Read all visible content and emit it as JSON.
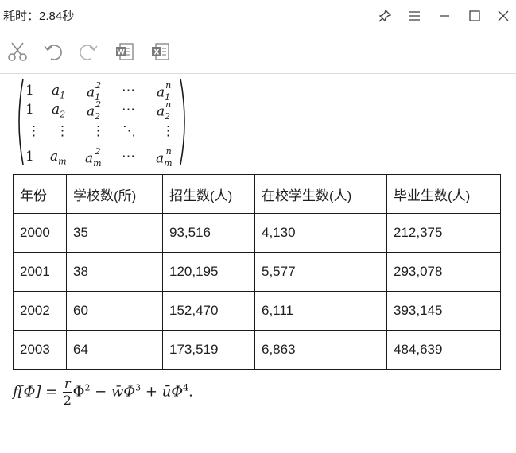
{
  "window": {
    "title": "耗时：2.84秒"
  },
  "toolbar": {
    "cut_icon": "scissors-icon",
    "undo_icon": "undo-icon",
    "redo_icon": "redo-icon",
    "word_icon": "word-export-icon",
    "excel_icon": "excel-export-icon"
  },
  "matrix": {
    "rows": [
      [
        "1",
        "a",
        "1",
        "a",
        "1",
        "2",
        "⋯",
        "a",
        "1",
        "n"
      ],
      [
        "1",
        "a",
        "2",
        "a",
        "2",
        "2",
        "⋯",
        "a",
        "2",
        "n"
      ],
      [
        "⋮",
        "⋮",
        "",
        "⋮",
        "",
        "",
        "⋱",
        "⋮",
        "",
        ""
      ],
      [
        "1",
        "a",
        "m",
        "a",
        "m",
        "2",
        "⋯",
        "a",
        "m",
        "n"
      ]
    ]
  },
  "table": {
    "headers": [
      "年份",
      "学校数(所)",
      "招生数(人)",
      "在校学生数(人)",
      "毕业生数(人)"
    ],
    "rows": [
      [
        "2000",
        "35",
        "93,516",
        "4,130",
        "212,375"
      ],
      [
        "2001",
        "38",
        "120,195",
        "5,577",
        "293,078"
      ],
      [
        "2002",
        "60",
        "152,470",
        "6,111",
        "393,145"
      ],
      [
        "2003",
        "64",
        "173,519",
        "6,863",
        "484,639"
      ]
    ]
  },
  "formula": {
    "lhs": "f[Φ] =",
    "frac_num": "r",
    "frac_den": "2",
    "term1": "Φ",
    "exp1": "2",
    "op1": "−",
    "term2": "w̄Φ",
    "exp2": "3",
    "op2": "+",
    "term3": "ūΦ",
    "exp3": "4",
    "tail": "."
  }
}
